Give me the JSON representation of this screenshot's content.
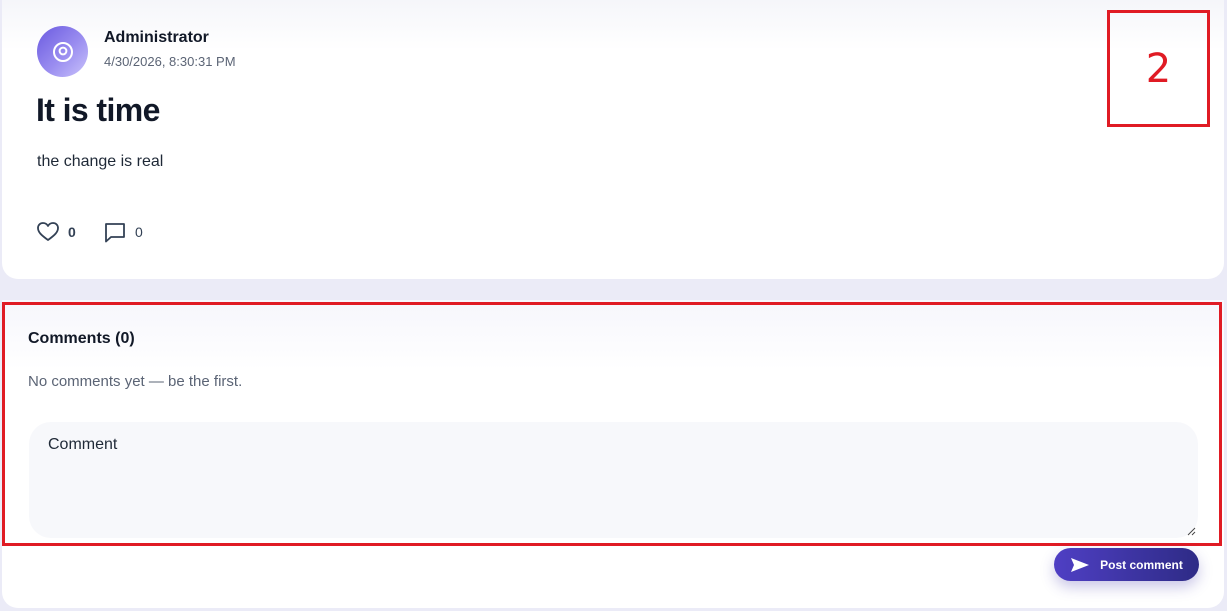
{
  "post": {
    "author": "Administrator",
    "timestamp": "4/30/2026, 8:30:31 PM",
    "title": "It is time",
    "body": "the change is real",
    "likes": "0",
    "comments_count": "0",
    "avatar_icon": "user-circle-icon"
  },
  "annotation": {
    "marker_label": "2",
    "color": "#e01b24"
  },
  "comments": {
    "heading": "Comments (0)",
    "empty_text": "No comments yet — be the first.",
    "input_placeholder": "Comment",
    "input_value": "",
    "post_button_label": "Post comment",
    "post_button_icon": "send-icon"
  },
  "colors": {
    "accent": "#4f3fc4",
    "accent_dark": "#2e2b86",
    "annotation": "#e01b24"
  }
}
